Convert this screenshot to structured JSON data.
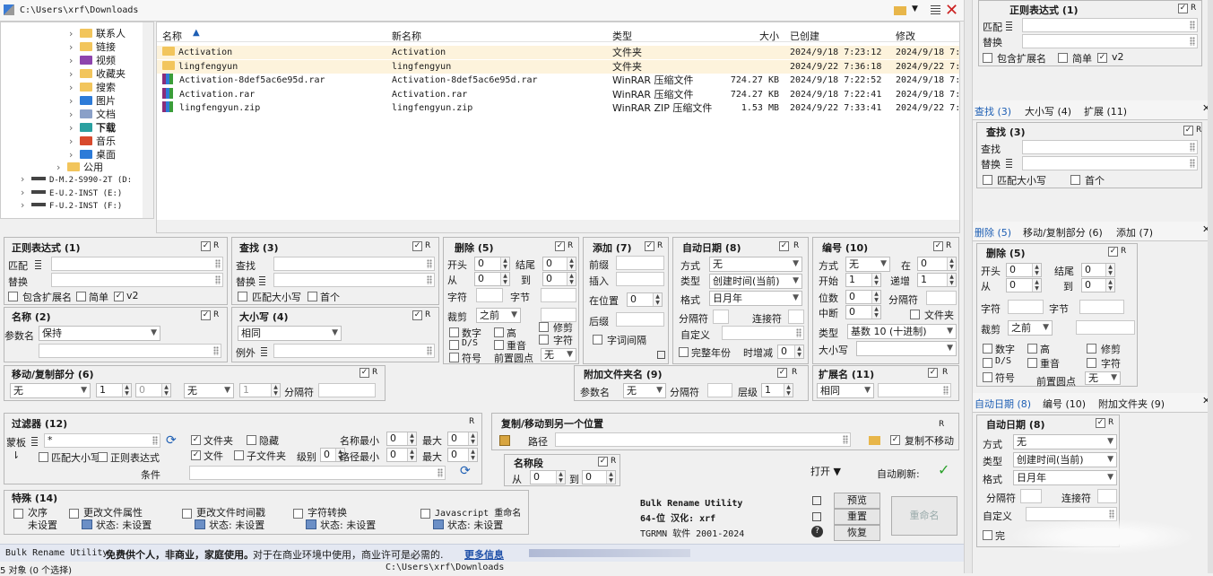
{
  "path_bar": {
    "path": "C:\\Users\\xrf\\Downloads"
  },
  "tree": [
    {
      "label": "联系人",
      "indent": 0
    },
    {
      "label": "链接",
      "indent": 0
    },
    {
      "label": "视频",
      "indent": 0
    },
    {
      "label": "收藏夹",
      "indent": 0
    },
    {
      "label": "搜索",
      "indent": 0
    },
    {
      "label": "图片",
      "indent": 0
    },
    {
      "label": "文档",
      "indent": 0
    },
    {
      "label": "下载",
      "indent": 0
    },
    {
      "label": "音乐",
      "indent": 0
    },
    {
      "label": "桌面",
      "indent": 0
    },
    {
      "label": "公用",
      "indent": 0
    },
    {
      "label": "D-M.2-S990-2T (D:",
      "indent": 0
    },
    {
      "label": "E-U.2-INST (E:)",
      "indent": 0
    },
    {
      "label": "F-U.2-INST (F:)",
      "indent": 0
    }
  ],
  "file_list": {
    "headers": [
      "名称",
      "新名称",
      "类型",
      "大小",
      "已创建",
      "修改"
    ],
    "rows": [
      {
        "name": "Activation",
        "new": "Activation",
        "type": "文件夹",
        "size": "",
        "created": "2024/9/18 7:23:12",
        "modified": "2024/9/18 7:",
        "kind": "folder"
      },
      {
        "name": "lingfengyun",
        "new": "lingfengyun",
        "type": "文件夹",
        "size": "",
        "created": "2024/9/22 7:36:18",
        "modified": "2024/9/22 7:",
        "kind": "folder"
      },
      {
        "name": "Activation-8def5ac6e95d.rar",
        "new": "Activation-8def5ac6e95d.rar",
        "type": "WinRAR 压缩文件",
        "size": "724.27 KB",
        "created": "2024/9/18 7:22:52",
        "modified": "2024/9/18 7:",
        "kind": "rar"
      },
      {
        "name": "Activation.rar",
        "new": "Activation.rar",
        "type": "WinRAR 压缩文件",
        "size": "724.27 KB",
        "created": "2024/9/18 7:22:41",
        "modified": "2024/9/18 7:",
        "kind": "rar"
      },
      {
        "name": "lingfengyun.zip",
        "new": "lingfengyun.zip",
        "type": "WinRAR ZIP 压缩文件",
        "size": "1.53 MB",
        "created": "2024/9/22 7:33:41",
        "modified": "2024/9/22 7:",
        "kind": "rar"
      }
    ]
  },
  "regex": {
    "title": "正则表达式  (1)",
    "match": "匹配",
    "replace": "替换",
    "ext": "包含扩展名",
    "simple": "简单",
    "v2": "v2"
  },
  "find": {
    "title": "查找  (3)",
    "find": "查找",
    "replace": "替换",
    "case": "匹配大小写",
    "first": "首个"
  },
  "delete": {
    "title": "删除  (5)",
    "start": "开头",
    "end": "结尾",
    "from": "从",
    "to": "到",
    "chars": "字符",
    "words": "字节",
    "crop": "裁剪",
    "crop_val": "之前",
    "digits": "数字",
    "high": "高",
    "ds": "D/S",
    "repeat": "重音",
    "symbol": "符号",
    "lead": "前置圆点",
    "lead_val": "无",
    "trim": "修剪",
    "chars2": "字符",
    "zero": "0"
  },
  "add": {
    "title": "添加  (7)",
    "prefix": "前缀",
    "insert": "插入",
    "at": "在位置",
    "suffix": "后缀",
    "wordspace": "字词间隔",
    "zero": "0"
  },
  "autodate": {
    "title": "自动日期  (8)",
    "mode": "方式",
    "mode_val": "无",
    "type": "类型",
    "type_val": "创建时间(当前)",
    "format": "格式",
    "format_val": "日月年",
    "sep": "分隔符",
    "conn": "连接符",
    "custom": "自定义",
    "fullyear": "完整年份",
    "offset": "时增减",
    "zero": "0"
  },
  "number": {
    "title": "编号  (10)",
    "mode": "方式",
    "mode_val": "无",
    "at": "在",
    "start": "开始",
    "step": "递增",
    "pad": "位数",
    "sep": "分隔符",
    "break": "中断",
    "folder": "文件夹",
    "type": "类型",
    "type_val": "基数 10 (十进制)",
    "case": "大小写",
    "zero": "0",
    "one": "1"
  },
  "name": {
    "title": "名称  (2)",
    "param": "参数名",
    "param_val": "保持"
  },
  "case": {
    "title": "大小写  (4)",
    "val": "相同",
    "except": "例外"
  },
  "move": {
    "title": "移动/复制部分  (6)",
    "val1": "无",
    "val2": "无",
    "n1": "1",
    "n2": "0",
    "n3": "1",
    "sep": "分隔符"
  },
  "append_folder": {
    "title": "附加文件夹名  (9)",
    "param": "参数名",
    "param_val": "无",
    "sep": "分隔符",
    "level": "层级",
    "level_val": "1"
  },
  "extension": {
    "title": "扩展名  (11)",
    "val": "相同"
  },
  "filter": {
    "title": "过滤器  (12)",
    "mask": "蒙板",
    "mask_val": "*",
    "folders": "文件夹",
    "hidden": "隐藏",
    "files": "文件",
    "subfolders": "子文件夹",
    "level": "级别",
    "level_val": "0",
    "namemin": "名称最小",
    "max1": "最大",
    "pathmin": "路径最小",
    "max2": "最大",
    "case": "匹配大小写",
    "regex": "正则表达式",
    "cond": "条件",
    "zero": "0"
  },
  "copymove": {
    "title": "复制/移动到另一个位置",
    "path": "路径",
    "nomove": "复制不移动"
  },
  "namefield": {
    "title": "名称段",
    "from": "从",
    "to": "到",
    "zero": "0"
  },
  "special": {
    "title": "特殊  (14)",
    "items": [
      {
        "label": "次序",
        "status": "未设置"
      },
      {
        "label": "更改文件属性",
        "status": "状态:  未设置"
      },
      {
        "label": "更改文件时间戳",
        "status": "状态:  未设置"
      },
      {
        "label": "字符转换",
        "status": "状态:  未设置"
      },
      {
        "label": "Javascript 重命名",
        "status": "状态:  未设置"
      }
    ]
  },
  "brand": {
    "line1": "Bulk Rename Utility",
    "line2": "64-位  汉化: xrf",
    "line3": "TGRMN 软件  2001-2024"
  },
  "actions": {
    "open": "打开",
    "auto_refresh": "自动刷新:",
    "preview": "预览",
    "reset": "重置",
    "revert": "恢复",
    "rename": "重命名"
  },
  "info": {
    "prefix": "Bulk Rename Utility",
    "bold": "免费供个人，非商业，家庭使用。",
    "rest": "对于在商业环境中使用，商业许可是必需的.",
    "link": "更多信息"
  },
  "status": {
    "count": "5 对象 (0 个选择)",
    "path": "C:\\Users\\xrf\\Downloads"
  },
  "side": {
    "regex_title": "正则表达式  (1)",
    "match": "匹配",
    "replace": "替换",
    "ext": "包含扩展名",
    "simple": "简单",
    "v2": "v2",
    "tabs1": [
      "查找 (3)",
      "大小写 (4)",
      "扩展 (11)"
    ],
    "find_title": "查找  (3)",
    "find": "查找",
    "freplace": "替换",
    "case": "匹配大小写",
    "first": "首个",
    "tabs2": [
      "删除 (5)",
      "移动/复制部分 (6)",
      "添加 (7)"
    ],
    "del_title": "删除  (5)",
    "start": "开头",
    "end": "结尾",
    "from": "从",
    "to": "到",
    "chars": "字符",
    "words": "字节",
    "crop": "裁剪",
    "crop_val": "之前",
    "digits": "数字",
    "high": "高",
    "trim": "修剪",
    "ds": "D/S",
    "repeat": "重音",
    "chars2": "字符",
    "symbol": "符号",
    "lead": "前置圆点",
    "lead_val": "无",
    "zero": "0",
    "tabs3": [
      "自动日期 (8)",
      "编号 (10)",
      "附加文件夹 (9)"
    ],
    "ad_title": "自动日期  (8)",
    "mode": "方式",
    "mode_val": "无",
    "type": "类型",
    "type_val": "创建时间(当前)",
    "format": "格式",
    "format_val": "日月年",
    "sep": "分隔符",
    "conn": "连接符",
    "custom": "自定义",
    "full": "完"
  },
  "colors": {
    "accent": "#1e5fb4",
    "border": "#b8b8b8",
    "selrow": "#fdf3dc",
    "link": "#1e4fa8"
  }
}
